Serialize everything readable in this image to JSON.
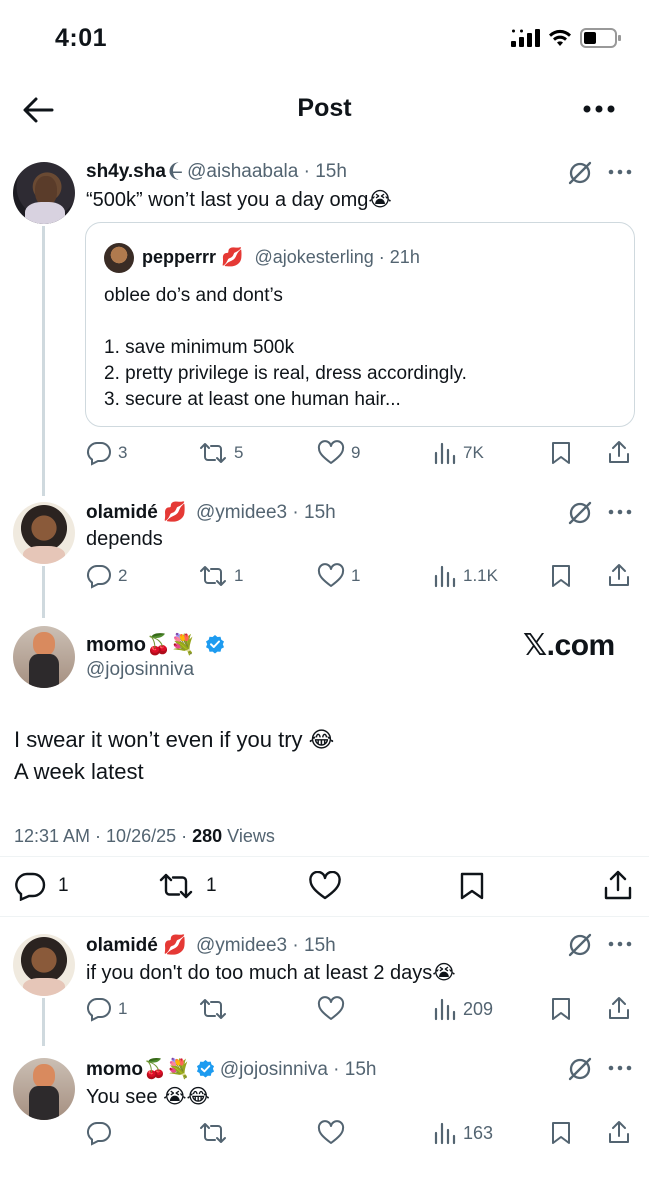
{
  "status_bar": {
    "time": "4:01"
  },
  "header": {
    "title": "Post"
  },
  "thread": [
    {
      "name": "sh4y.sha",
      "name_suffix": "❨̶",
      "handle": "@aishaabala",
      "time": "15h",
      "text": "“500k” won’t last you a day omg😭",
      "quote": {
        "name": "pepperrr 💋",
        "handle": "@ajokesterling",
        "time": "21h",
        "lines": [
          "oblee do’s and dont’s",
          "",
          "1. save minimum 500k",
          "2. pretty privilege is real, dress accordingly.",
          "3. secure at least one human hair..."
        ]
      },
      "stats": {
        "replies": "3",
        "reposts": "5",
        "likes": "9",
        "views": "7K"
      }
    },
    {
      "name": "olamidé 💋",
      "handle": "@ymidee3",
      "time": "15h",
      "text": "depends",
      "stats": {
        "replies": "2",
        "reposts": "1",
        "likes": "1",
        "views": "1.1K"
      }
    }
  ],
  "main_post": {
    "name": "momo🍒💐",
    "handle": "@jojosinniva",
    "watermark": "𝕏.com",
    "text_line1": "I swear it won’t even if you try 😂",
    "text_line2": "A week latest",
    "timestamp": "12:31 AM · 10/26/25 · ",
    "views_count": "280",
    "views_label": " Views",
    "stats": {
      "replies": "1",
      "reposts": "1"
    }
  },
  "replies": [
    {
      "name": "olamidé 💋",
      "handle": "@ymidee3",
      "time": "15h",
      "text": "if you don't do too much at least 2 days😭",
      "stats": {
        "replies": "1",
        "views": "209"
      }
    },
    {
      "name": "momo🍒💐",
      "handle": "@jojosinniva",
      "time": "15h",
      "text": "You see 😭😂",
      "stats": {
        "views": "163"
      }
    }
  ],
  "colors": {
    "verified": "#1d9bf0",
    "text": "#0f1419",
    "secondary": "#536471",
    "border": "#cfd9de"
  },
  "icons": [
    "back-arrow-icon",
    "more-icon",
    "grok-icon",
    "reply-icon",
    "repost-icon",
    "like-icon",
    "views-icon",
    "bookmark-icon",
    "share-icon",
    "verified-icon",
    "signal-icon",
    "wifi-icon",
    "battery-icon"
  ]
}
